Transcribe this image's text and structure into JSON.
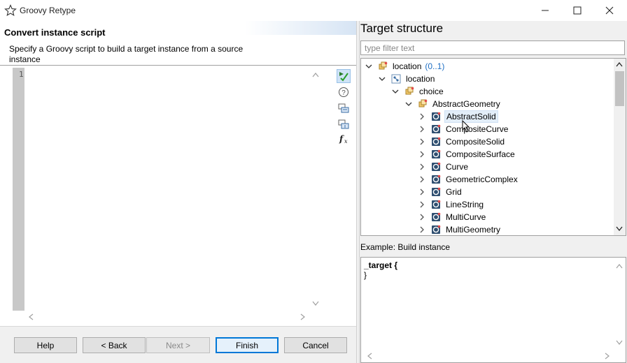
{
  "window": {
    "title": "Groovy Retype",
    "minimize_icon": "minimize-icon",
    "maximize_icon": "maximize-icon",
    "close_icon": "close-icon"
  },
  "left": {
    "heading": "Convert instance script",
    "description": "Specify a Groovy script to build a target instance from a source instance",
    "editor": {
      "line_number": "1",
      "content": ""
    },
    "tools": [
      "validate-icon",
      "help-icon",
      "insert-source-icon",
      "insert-target-icon",
      "function-icon"
    ]
  },
  "buttons": {
    "help": "Help",
    "back": "< Back",
    "next": "Next >",
    "finish": "Finish",
    "cancel": "Cancel"
  },
  "right": {
    "heading": "Target structure",
    "filter_placeholder": "type filter text",
    "tree": [
      {
        "label": "location",
        "cardinality": "(0..1)",
        "depth": 0,
        "expanded": true
      },
      {
        "label": "location",
        "cardinality": "",
        "depth": 1,
        "expanded": true
      },
      {
        "label": "choice",
        "cardinality": "",
        "depth": 2,
        "expanded": true
      },
      {
        "label": "AbstractGeometry",
        "cardinality": "",
        "depth": 3,
        "expanded": true
      },
      {
        "label": "AbstractSolid",
        "cardinality": "",
        "depth": 4,
        "expanded": false,
        "selected": true
      },
      {
        "label": "CompositeCurve",
        "cardinality": "",
        "depth": 4,
        "expanded": false
      },
      {
        "label": "CompositeSolid",
        "cardinality": "",
        "depth": 4,
        "expanded": false
      },
      {
        "label": "CompositeSurface",
        "cardinality": "",
        "depth": 4,
        "expanded": false
      },
      {
        "label": "Curve",
        "cardinality": "",
        "depth": 4,
        "expanded": false
      },
      {
        "label": "GeometricComplex",
        "cardinality": "",
        "depth": 4,
        "expanded": false
      },
      {
        "label": "Grid",
        "cardinality": "",
        "depth": 4,
        "expanded": false
      },
      {
        "label": "LineString",
        "cardinality": "",
        "depth": 4,
        "expanded": false
      },
      {
        "label": "MultiCurve",
        "cardinality": "",
        "depth": 4,
        "expanded": false
      },
      {
        "label": "MultiGeometry",
        "cardinality": "",
        "depth": 4,
        "expanded": false
      }
    ],
    "example_label": "Example: Build instance",
    "example_code": [
      "_target {",
      "}"
    ]
  },
  "colors": {
    "accent": "#0078d7",
    "cardinality": "#1f6fc4",
    "selection": "#e3eef9"
  }
}
